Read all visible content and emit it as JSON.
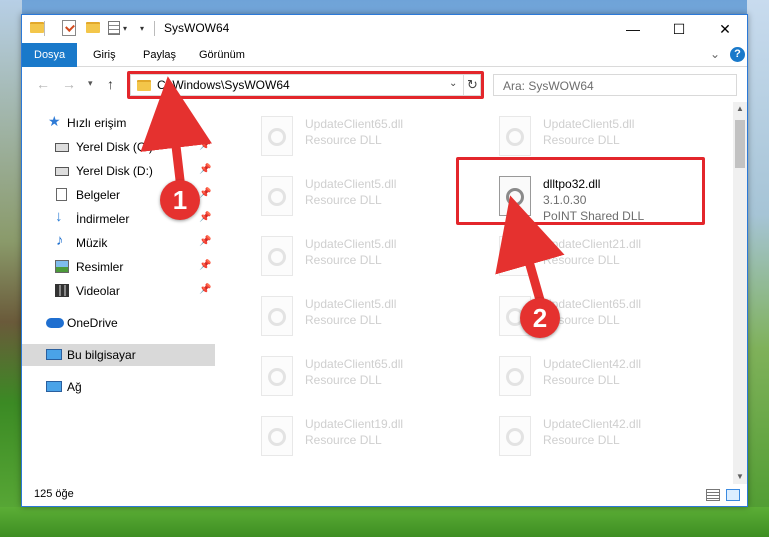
{
  "window": {
    "title": "SysWOW64",
    "controls": {
      "minimize": "—",
      "maximize": "☐",
      "close": "✕"
    }
  },
  "ribbon": {
    "tabs": [
      {
        "label": "Dosya",
        "active": true
      },
      {
        "label": "Giriş"
      },
      {
        "label": "Paylaş"
      },
      {
        "label": "Görünüm"
      }
    ],
    "help": "?"
  },
  "address": {
    "path": "C:\\Windows\\SysWOW64"
  },
  "search": {
    "placeholder": "Ara: SysWOW64"
  },
  "sidebar": {
    "items": [
      {
        "label": "Hızlı erişim",
        "icon": "star-icon"
      },
      {
        "label": "Yerel Disk (C:)",
        "icon": "drive-icon",
        "pinned": true
      },
      {
        "label": "Yerel Disk (D:)",
        "icon": "drive-icon",
        "pinned": true
      },
      {
        "label": "Belgeler",
        "icon": "documents-icon",
        "pinned": true
      },
      {
        "label": "İndirmeler",
        "icon": "download-icon",
        "pinned": true
      },
      {
        "label": "Müzik",
        "icon": "music-icon",
        "pinned": true
      },
      {
        "label": "Resimler",
        "icon": "pictures-icon",
        "pinned": true
      },
      {
        "label": "Videolar",
        "icon": "videos-icon",
        "pinned": true
      },
      {
        "label": "OneDrive",
        "icon": "cloud-icon"
      },
      {
        "label": "Bu bilgisayar",
        "icon": "computer-icon",
        "selected": true
      },
      {
        "label": "Ağ",
        "icon": "network-icon"
      }
    ]
  },
  "files": [
    {
      "name": "UpdateClient65.dll",
      "type": "Resource DLL"
    },
    {
      "name": "UpdateClient5.dll",
      "type": "Resource DLL"
    },
    {
      "name": "UpdateClient5.dll",
      "type": "Resource DLL"
    },
    {
      "name": "dlltpo32.dll",
      "version": "3.1.0.30",
      "type": "PoINT Shared DLL",
      "highlighted": true
    },
    {
      "name": "UpdateClient5.dll",
      "type": "Resource DLL"
    },
    {
      "name": "UpdateClient21.dll",
      "type": "Resource DLL"
    },
    {
      "name": "UpdateClient5.dll",
      "type": "Resource DLL"
    },
    {
      "name": "UpdateClient65.dll",
      "type": "Resource DLL"
    },
    {
      "name": "UpdateClient65.dll",
      "type": "Resource DLL"
    },
    {
      "name": "UpdateClient42.dll",
      "type": "Resource DLL"
    },
    {
      "name": "UpdateClient19.dll",
      "type": "Resource DLL"
    },
    {
      "name": "UpdateClient42.dll",
      "type": "Resource DLL"
    }
  ],
  "status": {
    "item_count": "125 öğe"
  },
  "callouts": [
    "1",
    "2"
  ],
  "colors": {
    "accent": "#1979ca",
    "highlight": "#e3262b",
    "callout": "#e5312f"
  }
}
